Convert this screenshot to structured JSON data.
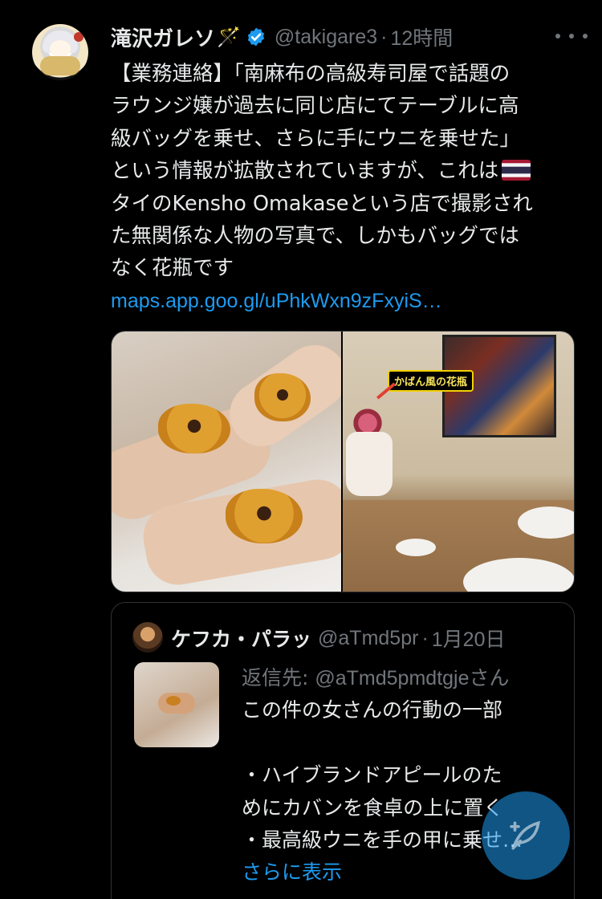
{
  "tweet": {
    "display_name": "滝沢ガレソ",
    "name_emoji": "🪄",
    "handle": "@takigare3",
    "separator": "·",
    "time": "12時間",
    "text_lines": [
      "【業務連絡】「南麻布の高級寿司屋で話題の",
      "ラウンジ嬢が過去に同じ店にてテーブルに高",
      "級バッグを乗せ、さらに手にウニを乗せた」",
      "という情報が拡散されていますが、これは",
      "タイのKensho Omakaseという店で撮影され",
      "た無関係な人物の写真で、しかもバッグでは",
      "なく花瓶です"
    ],
    "link": "maps.app.goo.gl/uPhkWxn9zFxyiS…",
    "image_caption": "かばん風の花瓶"
  },
  "quoted_tweet": {
    "display_name": "ケフカ・パラッ",
    "handle": "@aTmd5pr",
    "separator": "·",
    "date": "1月20日",
    "reply_prefix": "返信先: ",
    "reply_to": "@aTmd5pmdtgje",
    "reply_suffix": "さん",
    "body_lines": [
      "この件の女さんの行動の一部",
      "",
      "・ハイブランドアピールのた",
      "めにカバンを食卓の上に置く",
      "・最高級ウニを手の甲に乗せ…"
    ],
    "show_more": "さらに表示"
  },
  "colors": {
    "background": "#000000",
    "text": "#e7e9ea",
    "muted": "#71767b",
    "link": "#1d9bf0",
    "border": "#2f3336"
  },
  "icons": {
    "verified": "verified-badge-icon",
    "more": "more-dots-icon",
    "compose": "compose-feather-icon"
  }
}
